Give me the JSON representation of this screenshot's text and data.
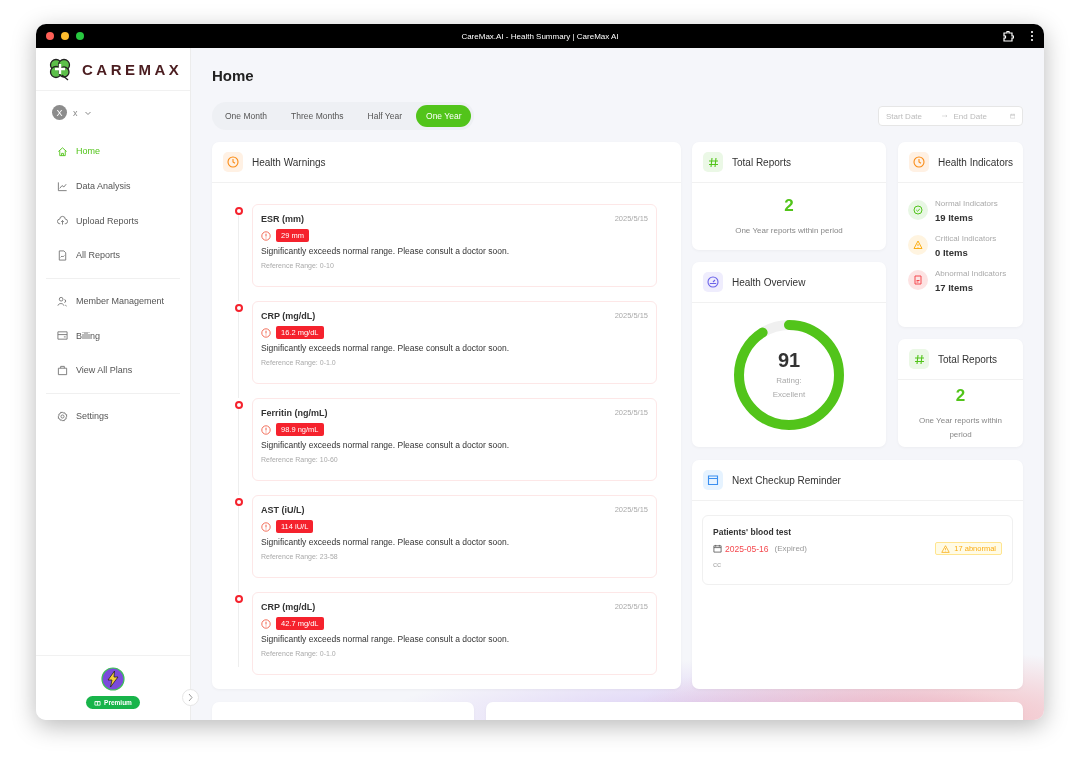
{
  "window": {
    "title": "CareMax.AI - Health Summary | CareMax AI"
  },
  "sidebar": {
    "logo": "CAREMAX",
    "user": {
      "initial": "X",
      "name": "x"
    },
    "nav_groups": [
      {
        "items": [
          {
            "label": "Home",
            "selected": true
          },
          {
            "label": "Data Analysis",
            "selected": false
          },
          {
            "label": "Upload Reports",
            "selected": false
          },
          {
            "label": "All Reports",
            "selected": false
          }
        ]
      },
      {
        "items": [
          {
            "label": "Member Management",
            "selected": false
          },
          {
            "label": "Billing",
            "selected": false
          },
          {
            "label": "View All Plans",
            "selected": false
          }
        ]
      },
      {
        "items": [
          {
            "label": "Settings",
            "selected": false
          }
        ]
      }
    ],
    "plan_badge": "Premium"
  },
  "page_title": "Home",
  "period_tabs": [
    {
      "label": "One Month",
      "selected": false
    },
    {
      "label": "Three Months",
      "selected": false
    },
    {
      "label": "Half Year",
      "selected": false
    },
    {
      "label": "One Year",
      "selected": true
    }
  ],
  "date_range": {
    "start_placeholder": "Start Date",
    "end_placeholder": "End Date"
  },
  "health_warnings": {
    "title": "Health Warnings",
    "items": [
      {
        "name": "ESR (mm)",
        "date": "2025/5/15",
        "value": "29 mm",
        "message": "Significantly exceeds normal range. Please consult a doctor soon.",
        "reference": "Reference Range: 0-10"
      },
      {
        "name": "CRP (mg/dL)",
        "date": "2025/5/15",
        "value": "16.2 mg/dL",
        "message": "Significantly exceeds normal range. Please consult a doctor soon.",
        "reference": "Reference Range: 0-1.0"
      },
      {
        "name": "Ferritin (ng/mL)",
        "date": "2025/5/15",
        "value": "98.9 ng/mL",
        "message": "Significantly exceeds normal range. Please consult a doctor soon.",
        "reference": "Reference Range: 10-60"
      },
      {
        "name": "AST (iU/L)",
        "date": "2025/5/15",
        "value": "114 iU/L",
        "message": "Significantly exceeds normal range. Please consult a doctor soon.",
        "reference": "Reference Range: 23-58"
      },
      {
        "name": "CRP (mg/dL)",
        "date": "2025/5/15",
        "value": "42.7 mg/dL",
        "message": "Significantly exceeds normal range. Please consult a doctor soon.",
        "reference": "Reference Range: 0-1.0"
      }
    ]
  },
  "total_reports": [
    {
      "title": "Total Reports",
      "count": "2",
      "caption": "One Year reports within period"
    },
    {
      "title": "Total Reports",
      "count": "2",
      "caption": "One Year reports within period"
    }
  ],
  "health_overview": {
    "title": "Health Overview",
    "score": "91",
    "rating": "Rating: Excellent",
    "level": 0.91
  },
  "health_indicators": {
    "title": "Health Indicators",
    "items": [
      {
        "kind": "normal",
        "label": "Normal Indicators",
        "count": "19 Items"
      },
      {
        "kind": "critical",
        "label": "Critical Indicators",
        "count": "0 Items"
      },
      {
        "kind": "abnormal",
        "label": "Abnormal Indicators",
        "count": "17 Items"
      }
    ]
  },
  "checkup_reminder": {
    "title": "Next Checkup Reminder",
    "items": [
      {
        "name": "Patients' blood test",
        "date": "2025-05-16",
        "expired": true,
        "status": "(Expired)",
        "note": "cc",
        "badge": "17 abnormal"
      }
    ]
  }
}
